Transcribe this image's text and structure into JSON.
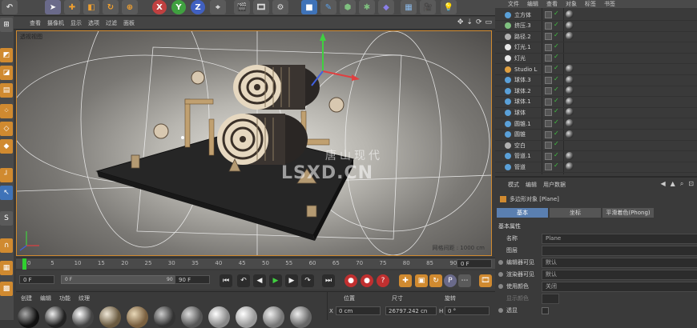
{
  "viewport": {
    "menu": [
      "查看",
      "摄像机",
      "显示",
      "选项",
      "过滤",
      "面板"
    ],
    "title": "透视视图",
    "grid_label": "网格间距 : 1000 cm"
  },
  "watermark": {
    "cn": "唐山现代",
    "en": "LSXD.CN"
  },
  "toolbar": {
    "axis_x": "X",
    "axis_y": "Y",
    "axis_z": "Z"
  },
  "object_manager": {
    "menu": [
      "文件",
      "编辑",
      "查看",
      "对象",
      "标签",
      "书签"
    ],
    "objects": [
      {
        "name": "立方体",
        "color": "#5aa0d8"
      },
      {
        "name": "挤压.3",
        "color": "#7fc07f"
      },
      {
        "name": "路径.2",
        "color": "#b0b0b0"
      },
      {
        "name": "灯光.1",
        "color": "#e8e8e8"
      },
      {
        "name": "灯光",
        "color": "#e8e8e8"
      },
      {
        "name": "Studio L",
        "color": "#e0a040"
      },
      {
        "name": "球体.3",
        "color": "#5aa0d8"
      },
      {
        "name": "球体.2",
        "color": "#5aa0d8"
      },
      {
        "name": "球体.1",
        "color": "#5aa0d8"
      },
      {
        "name": "球体",
        "color": "#5aa0d8"
      },
      {
        "name": "圆锥.1",
        "color": "#5aa0d8"
      },
      {
        "name": "圆锥",
        "color": "#5aa0d8"
      },
      {
        "name": "空白",
        "color": "#b0b0b0"
      },
      {
        "name": "管道.1",
        "color": "#5aa0d8"
      },
      {
        "name": "管道",
        "color": "#5aa0d8"
      }
    ]
  },
  "attributes": {
    "menu": [
      "模式",
      "编辑",
      "用户数据"
    ],
    "object_title": "多边形对象 [Plane]",
    "tabs": [
      "基本",
      "坐标",
      "平滑着色(Phong)"
    ],
    "section": "基本属性",
    "fields": [
      {
        "label": "名称",
        "value": "Plane"
      },
      {
        "label": "图层",
        "value": ""
      },
      {
        "label": "编辑器可见",
        "value": "默认"
      },
      {
        "label": "渲染器可见",
        "value": "默认"
      },
      {
        "label": "使用颜色",
        "value": "关闭"
      },
      {
        "label": "显示颜色",
        "value": ""
      },
      {
        "label": "透显",
        "value": ""
      }
    ]
  },
  "timeline": {
    "ticks": [
      "0",
      "5",
      "10",
      "15",
      "20",
      "25",
      "30",
      "35",
      "40",
      "45",
      "50",
      "55",
      "60",
      "65",
      "70",
      "75",
      "80",
      "85",
      "90"
    ],
    "current_frame": "0 F",
    "start": "0 F",
    "range_start": "0 F",
    "range_end": "90 F",
    "end": "90 F"
  },
  "material_manager": {
    "menu": [
      "创建",
      "编辑",
      "功能",
      "纹理"
    ]
  },
  "coordinates": {
    "headers": [
      "位置",
      "尺寸",
      "旋转"
    ],
    "x_pos": "0 cm",
    "x_size": "26797.242 cn",
    "h_label": "H",
    "h_rot": "0 °"
  }
}
